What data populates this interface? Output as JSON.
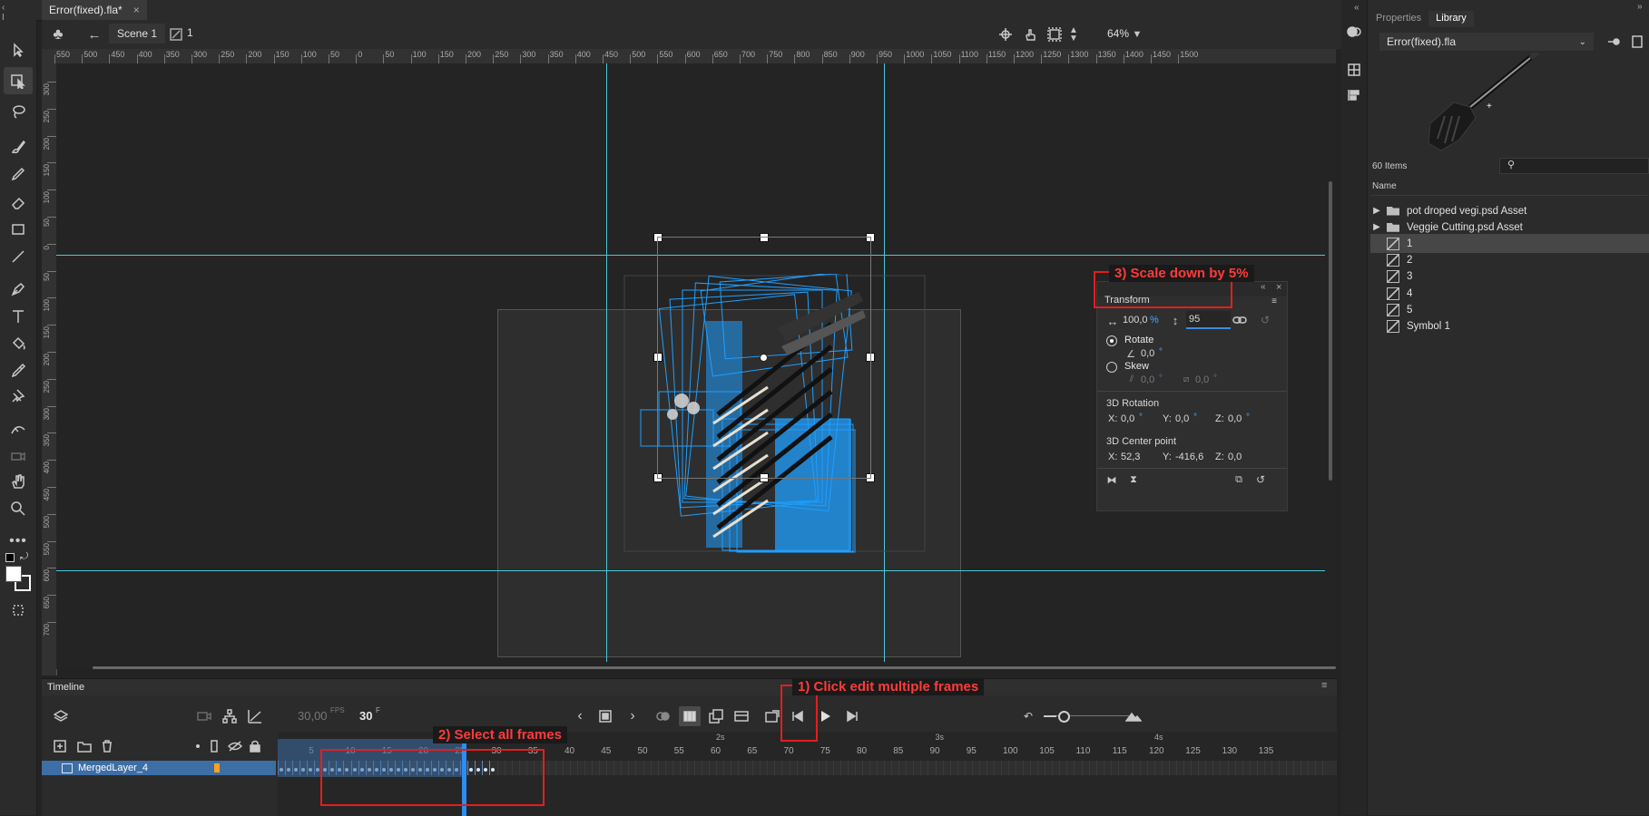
{
  "document": {
    "tab_title": "Error(fixed).fla*",
    "close_glyph": "×"
  },
  "editbar": {
    "scene_label": "Scene 1",
    "symbol_label": "1",
    "zoom_value": "64%"
  },
  "rulers": {
    "top_labels": [
      "550",
      "500",
      "450",
      "400",
      "350",
      "300",
      "250",
      "200",
      "150",
      "100",
      "50",
      "0",
      "50",
      "100",
      "150",
      "200",
      "250",
      "300",
      "350",
      "400",
      "450",
      "500",
      "550",
      "600",
      "650",
      "700",
      "750",
      "800",
      "850",
      "900",
      "950",
      "1000",
      "1050",
      "1100",
      "1150",
      "1200",
      "1250",
      "1300",
      "1350",
      "1400",
      "1450",
      "1500"
    ],
    "left_labels": [
      "300",
      "250",
      "200",
      "150",
      "100",
      "50",
      "0",
      "50",
      "100",
      "150",
      "200",
      "250",
      "300",
      "350",
      "400",
      "450",
      "500",
      "550",
      "600",
      "650",
      "700"
    ]
  },
  "transform": {
    "title": "Transform",
    "width_value": "100,0",
    "width_unit": "%",
    "height_value": "95",
    "rotate_label": "Rotate",
    "rotate_value": "0,0",
    "skew_label": "Skew",
    "skew_h": "0,0",
    "skew_v": "0,0",
    "degree_glyph": "°",
    "rot3d_title": "3D Rotation",
    "rot3d_x_label": "X:",
    "rot3d_x": "0,0",
    "rot3d_y_label": "Y:",
    "rot3d_y": "0,0",
    "rot3d_z_label": "Z:",
    "rot3d_z": "0,0",
    "center_title": "3D Center point",
    "center_x_label": "X:",
    "center_x": "52,3",
    "center_y_label": "Y:",
    "center_y": "-416,6",
    "center_z_label": "Z:",
    "center_z": "0,0"
  },
  "timeline": {
    "title": "Timeline",
    "fps_value": "30,00",
    "fps_unit": "FPS",
    "frame_value": "30",
    "frame_unit": "F",
    "layer_name": "MergedLayer_4",
    "time_markers": [
      "2s",
      "3s",
      "4s"
    ],
    "frame_labels": [
      "5",
      "10",
      "15",
      "20",
      "25",
      "30",
      "35",
      "40",
      "45",
      "50",
      "55",
      "60",
      "65",
      "70",
      "75",
      "80",
      "85",
      "90",
      "95",
      "100",
      "105",
      "110",
      "115",
      "120",
      "125",
      "130",
      "135"
    ]
  },
  "library": {
    "tabs": [
      "Properties",
      "Library"
    ],
    "file_name": "Error(fixed).fla",
    "item_count": "60 Items",
    "column_name": "Name",
    "items": [
      {
        "name": "pot droped vegi.psd Asset",
        "type": "folder"
      },
      {
        "name": "Veggie Cutting.psd Asset",
        "type": "folder"
      },
      {
        "name": "1",
        "type": "symbol"
      },
      {
        "name": "2",
        "type": "symbol"
      },
      {
        "name": "3",
        "type": "symbol"
      },
      {
        "name": "4",
        "type": "symbol"
      },
      {
        "name": "5",
        "type": "symbol"
      },
      {
        "name": "Symbol 1",
        "type": "symbol"
      }
    ]
  },
  "annotations": {
    "step1": "1) Click edit multiple frames",
    "step2": "2) Select all frames",
    "step3": "3) Scale down by 5%"
  },
  "colors": {
    "accent": "#4aa8ff",
    "guide": "#49c7d8",
    "annotation_red": "#e31e1e",
    "selection_blue": "#1f9fff",
    "layer_selected": "#3d6ea5"
  },
  "icons": [
    "arrow-tool-icon",
    "free-transform-tool-icon",
    "lasso-icon",
    "brush-icon",
    "pencil-icon",
    "eraser-icon",
    "rectangle-icon",
    "line-icon",
    "pen-icon",
    "text-tool-icon",
    "paint-bucket-icon",
    "eyedropper-icon",
    "pin-icon",
    "asset-warp-icon",
    "camera-icon",
    "hand-icon",
    "zoom-icon",
    "more-tools-icon",
    "edit-multiple-frames-icon",
    "play-icon",
    "search-icon"
  ]
}
